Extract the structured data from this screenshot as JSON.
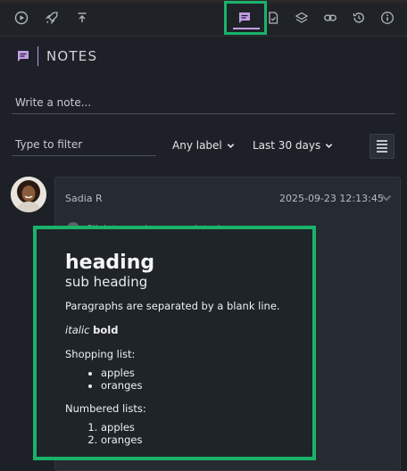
{
  "toolbar": {
    "left_icons": [
      "play-circle-icon",
      "rocket-icon",
      "upload-icon"
    ],
    "right_icons": [
      "notes-chat-icon",
      "checklist-icon",
      "layers-icon",
      "link-icon",
      "history-icon",
      "info-icon"
    ],
    "active_tab": "notes",
    "accent_color": "#c39ce6",
    "highlight_color": "#19b36b"
  },
  "header": {
    "title": "NOTES"
  },
  "composer": {
    "placeholder": "Write a note..."
  },
  "filters": {
    "filter_placeholder": "Type to filter",
    "label_dropdown": "Any label",
    "range_dropdown": "Last 30 days"
  },
  "note": {
    "author": "Sadia R",
    "timestamp": "2025-09-23 12:13:45",
    "mark_completed": "Click to mark as completed.",
    "heading": "heading",
    "subheading": "sub heading",
    "paragraph": "Paragraphs are separated by a blank line.",
    "italic": "italic",
    "bold": "bold",
    "shopping_label": "Shopping list:",
    "shopping_items": [
      "apples",
      "oranges"
    ],
    "numbered_label": "Numbered lists:",
    "numbered_items": [
      "apples",
      "oranges"
    ]
  }
}
